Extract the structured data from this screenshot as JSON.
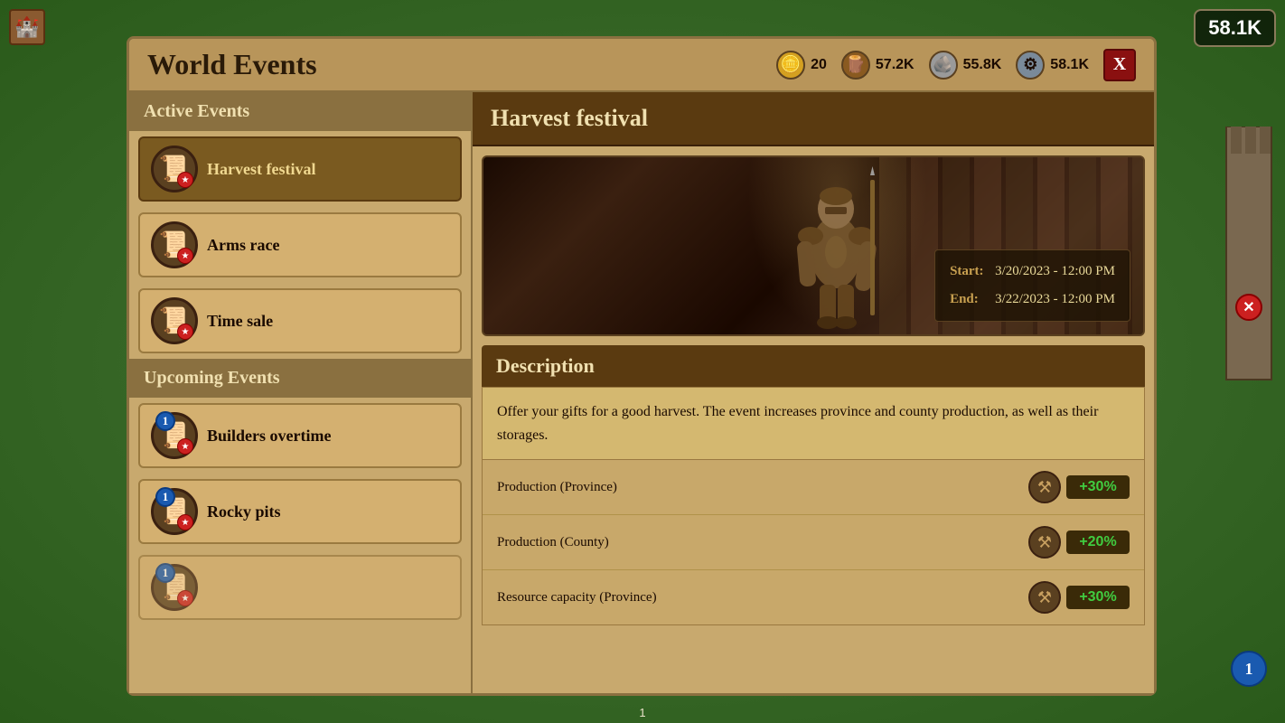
{
  "ui": {
    "title": "World Events",
    "top_right_currency": "58.1K",
    "close_btn": "X",
    "bottom_bar": "1"
  },
  "currency_bar": [
    {
      "id": "gold",
      "icon_char": "🪙",
      "value": "20",
      "color": "gold"
    },
    {
      "id": "wood",
      "icon_char": "🪵",
      "value": "57.2K",
      "color": "wood"
    },
    {
      "id": "stone",
      "icon_char": "🪨",
      "value": "55.8K",
      "color": "stone"
    },
    {
      "id": "iron",
      "icon_char": "⚙",
      "value": "58.1K",
      "color": "iron"
    }
  ],
  "active_section": {
    "label": "Active Events",
    "items": [
      {
        "name": "Harvest festival",
        "selected": true
      },
      {
        "name": "Arms race",
        "selected": false
      },
      {
        "name": "Time sale",
        "selected": false
      }
    ]
  },
  "upcoming_section": {
    "label": "Upcoming Events",
    "items": [
      {
        "name": "Builders overtime",
        "badge": "1"
      },
      {
        "name": "Rocky pits",
        "badge": "1"
      }
    ]
  },
  "detail": {
    "title": "Harvest festival",
    "start_label": "Start:",
    "start_date": "3/20/2023 - 12:00 PM",
    "end_label": "End:",
    "end_date": "3/22/2023 - 12:00 PM",
    "description_header": "Description",
    "description_text": "Offer your gifts for a good harvest. The event increases province and county production, as well as their storages.",
    "bonuses": [
      {
        "label": "Production (Province)",
        "pct": "+30%"
      },
      {
        "label": "Production (County)",
        "pct": "+20%"
      },
      {
        "label": "Resource capacity (Province)",
        "pct": "+30%"
      }
    ]
  }
}
